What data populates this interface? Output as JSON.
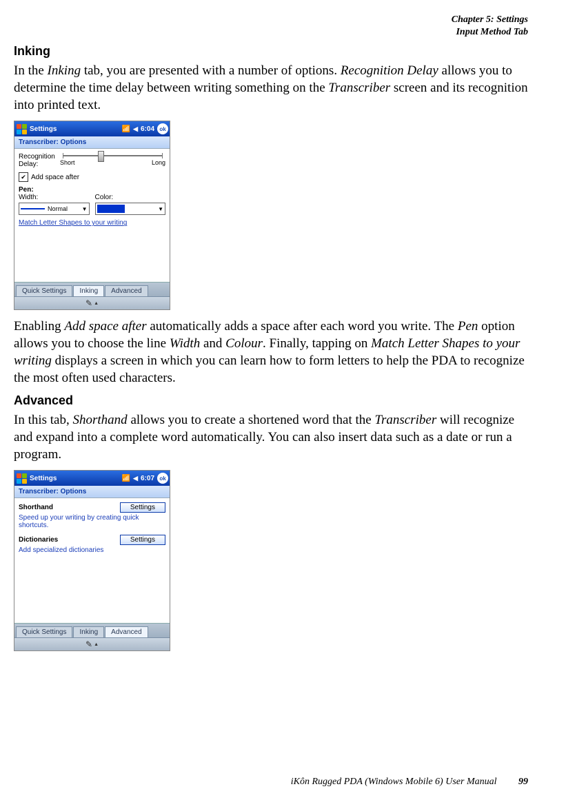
{
  "header": {
    "chapter": "Chapter 5:  Settings",
    "section": "Input Method Tab"
  },
  "sections": {
    "inking": {
      "heading": "Inking",
      "para1_a": "In the ",
      "para1_b": "Inking",
      "para1_c": " tab, you are presented with a number of options. ",
      "para1_d": "Recognition Delay",
      "para1_e": " allows you to determine the time delay between writing something on the ",
      "para1_f": "Transcriber",
      "para1_g": " screen and its recognition into printed text.",
      "para2_a": "Enabling ",
      "para2_b": "Add space after",
      "para2_c": " automatically adds a space after each word you write. The ",
      "para2_d": "Pen",
      "para2_e": " option allows you to choose the line ",
      "para2_f": "Width",
      "para2_g": " and ",
      "para2_h": "Colour",
      "para2_i": ". Finally, tapping on ",
      "para2_j": "Match Letter Shapes to your writing",
      "para2_k": " displays a screen in which you can learn how to form letters to help the PDA to recognize the most often used characters."
    },
    "advanced": {
      "heading": "Advanced",
      "para_a": "In this tab, ",
      "para_b": "Shorthand",
      "para_c": " allows you to create a shortened word that the ",
      "para_d": "Transcriber",
      "para_e": " will recognize and expand into a complete word automatically. You can also insert data such as a date or run a program."
    }
  },
  "shot1": {
    "titlebar": "Settings",
    "time": "6:04",
    "ok": "ok",
    "subtitle": "Transcriber: Options",
    "recog_label_l1": "Recognition",
    "recog_label_l2": "Delay:",
    "slider_short": "Short",
    "slider_long": "Long",
    "addspace": "Add space after",
    "pen_label": "Pen:",
    "width_label": "Width:",
    "color_label": "Color:",
    "width_value": "Normal",
    "link": "Match Letter Shapes to your writing",
    "tabs": [
      "Quick Settings",
      "Inking",
      "Advanced"
    ],
    "active_tab": 1
  },
  "shot2": {
    "titlebar": "Settings",
    "time": "6:07",
    "ok": "ok",
    "subtitle": "Transcriber: Options",
    "shorthand_h": "Shorthand",
    "shorthand_btn": "Settings",
    "shorthand_desc": "Speed up your writing by creating quick shortcuts.",
    "dict_h": "Dictionaries",
    "dict_btn": "Settings",
    "dict_desc": "Add specialized dictionaries",
    "tabs": [
      "Quick Settings",
      "Inking",
      "Advanced"
    ],
    "active_tab": 2
  },
  "footer": {
    "text": "iKôn Rugged PDA (Windows Mobile 6) User Manual",
    "page": "99"
  }
}
